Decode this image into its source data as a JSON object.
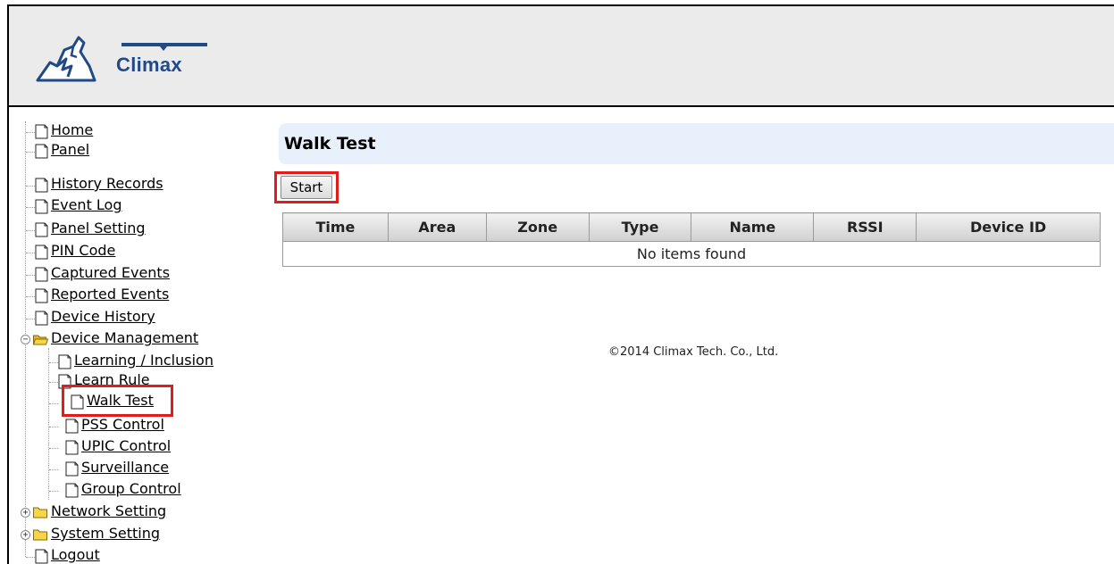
{
  "header": {
    "brand": "Climax"
  },
  "nav": {
    "home": "Home",
    "panel": "Panel",
    "history_records": "History Records",
    "event_log": "Event Log",
    "panel_setting": "Panel Setting",
    "pin_code": "PIN Code",
    "captured_events": "Captured Events",
    "reported_events": "Reported Events",
    "device_history": "Device History",
    "device_management": "Device Management",
    "learning_inclusion": "Learning / Inclusion",
    "learn_rule": "Learn Rule",
    "walk_test": "Walk Test",
    "pss_control": "PSS Control",
    "upic_control": "UPIC Control",
    "surveillance": "Surveillance",
    "group_control": "Group Control",
    "network_setting": "Network Setting",
    "system_setting": "System Setting",
    "logout": "Logout"
  },
  "main": {
    "title": "Walk Test",
    "start_label": "Start",
    "columns": [
      "Time",
      "Area",
      "Zone",
      "Type",
      "Name",
      "RSSI",
      "Device ID"
    ],
    "empty_text": "No items found"
  },
  "footer": {
    "copyright": "©2014 Climax Tech. Co., Ltd."
  },
  "colors": {
    "highlight": "#e21b1b",
    "title_bar": "#e8f0fb",
    "brand": "#1f4a86"
  }
}
